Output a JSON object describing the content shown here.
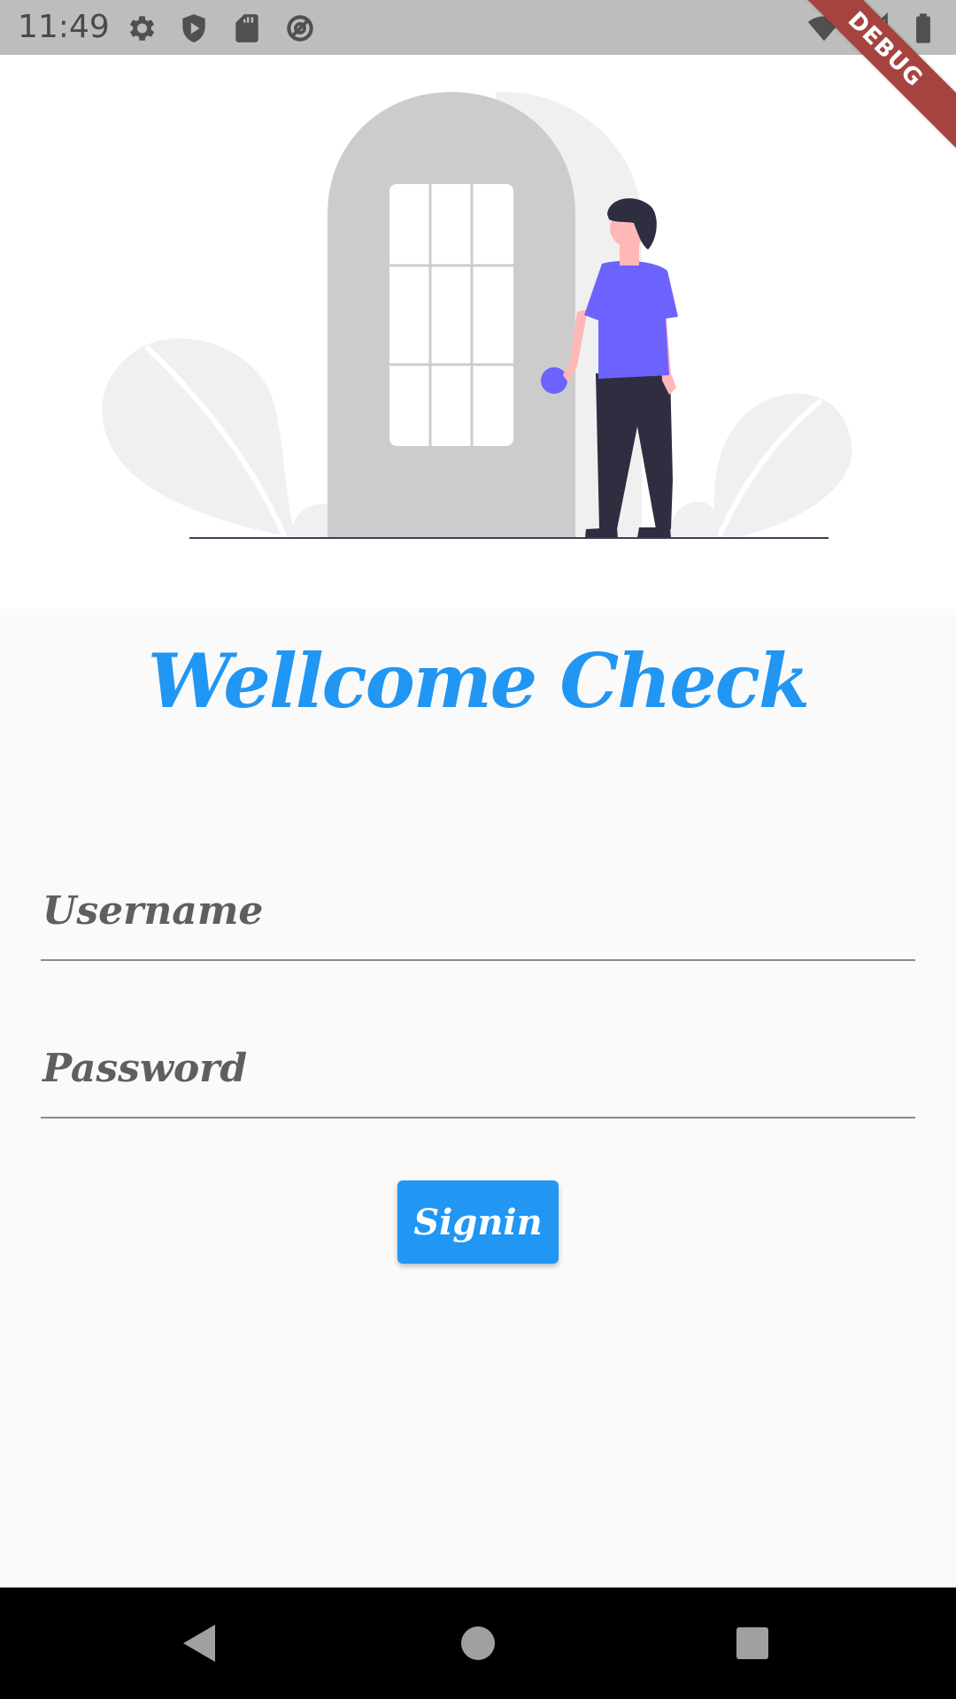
{
  "status_bar": {
    "time": "11:49",
    "left_icons": [
      "settings-icon",
      "shield-play-icon",
      "sd-card-icon",
      "data-saver-icon"
    ],
    "right_icons": [
      "wifi-icon",
      "signal-icon",
      "battery-icon"
    ]
  },
  "debug_banner": {
    "label": "DEBUG",
    "color": "#a5443f"
  },
  "hero": {
    "illustration": "person-at-door-illustration"
  },
  "login": {
    "title": "Wellcome Check",
    "username": {
      "label": "Username",
      "value": ""
    },
    "password": {
      "label": "Password",
      "value": ""
    },
    "signin_label": "Signin"
  },
  "navigation": {
    "items": [
      "back-icon",
      "home-icon",
      "recents-icon"
    ]
  },
  "colors": {
    "accent": "#2196f3",
    "status_bar": "#bdbdbd",
    "background": "#fafafa",
    "person_shirt": "#6c63ff"
  }
}
